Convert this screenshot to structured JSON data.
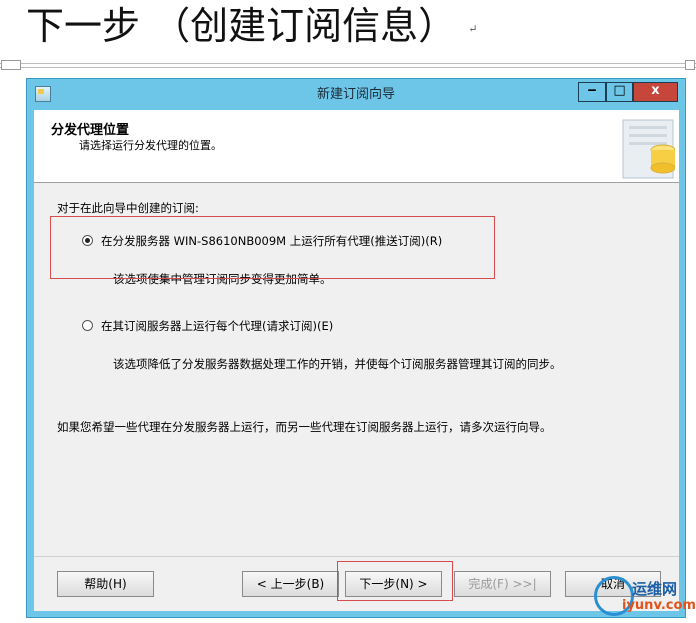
{
  "doc": {
    "heading": "下一步 （创建订阅信息）",
    "return_mark": "↵"
  },
  "window": {
    "title": "新建订阅向导",
    "controls": {
      "minimize": "‒",
      "maximize": "□",
      "close": "x"
    }
  },
  "header": {
    "title": "分发代理位置",
    "subtitle": "请选择运行分发代理的位置。"
  },
  "body": {
    "intro": "对于在此向导中创建的订阅:",
    "options": [
      {
        "label": "在分发服务器 WIN-S8610NB009M 上运行所有代理(推送订阅)(R)",
        "description": "该选项使集中管理订阅同步变得更加简单。",
        "selected": true
      },
      {
        "label": "在其订阅服务器上运行每个代理(请求订阅)(E)",
        "description": "该选项降低了分发服务器数据处理工作的开销，并使每个订阅服务器管理其订阅的同步。",
        "selected": false
      }
    ],
    "note": "如果您希望一些代理在分发服务器上运行，而另一些代理在订阅服务器上运行，请多次运行向导。"
  },
  "buttons": {
    "help": "帮助(H)",
    "back": "< 上一步(B)",
    "next": "下一步(N) >",
    "finish": "完成(F) >>|",
    "cancel": "取消"
  },
  "watermark": {
    "name": "运维网",
    "url": "iyunv.com"
  },
  "colors": {
    "titlebar": "#6dc6e8",
    "close": "#c7463c",
    "highlight": "#d64b4b"
  }
}
